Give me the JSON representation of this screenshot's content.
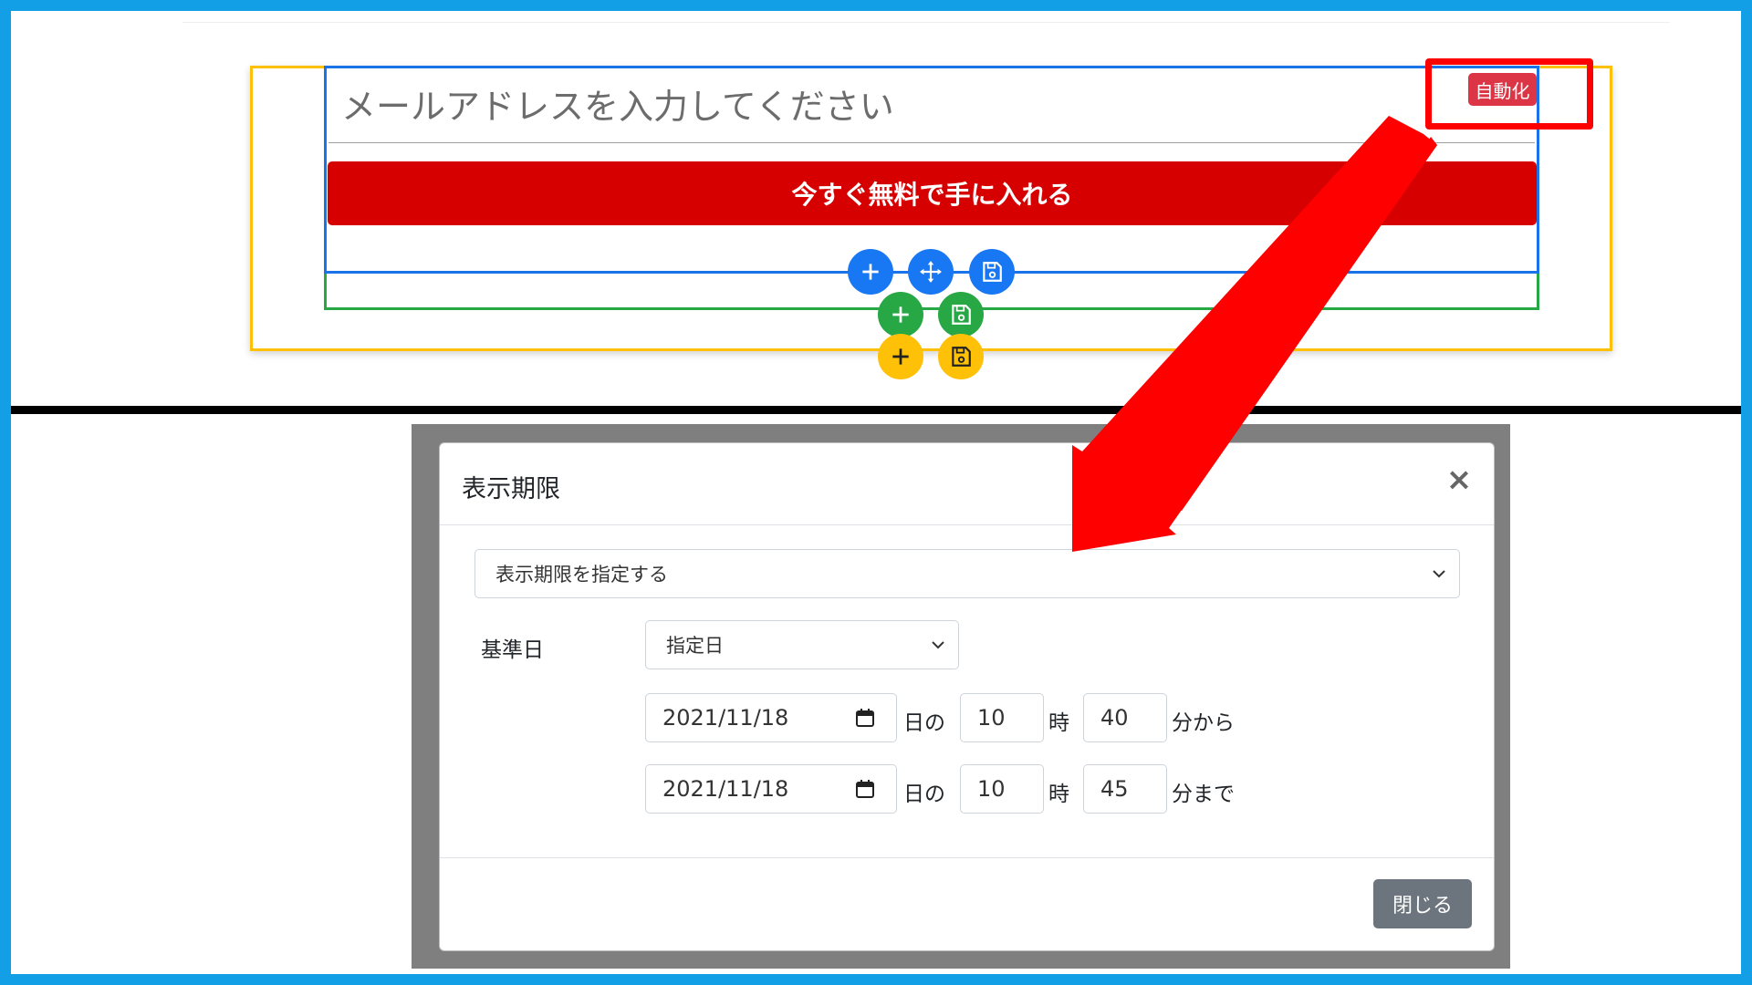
{
  "editor": {
    "email_placeholder": "メールアドレスを入力してください",
    "cta_label": "今すぐ無料で手に入れる",
    "auto_badge": "自動化",
    "block_controls": [
      {
        "icon": "plus-icon",
        "color": "#1877f2"
      },
      {
        "icon": "move-icon",
        "color": "#1877f2"
      },
      {
        "icon": "save-icon",
        "color": "#1877f2"
      },
      {
        "icon": "plus-icon",
        "color": "#28a745"
      },
      {
        "icon": "save-icon",
        "color": "#28a745"
      },
      {
        "icon": "plus-icon",
        "color": "#ffc107"
      },
      {
        "icon": "save-icon",
        "color": "#ffc107"
      }
    ]
  },
  "modal": {
    "title": "表示期限",
    "close_symbol": "×",
    "mode_select": "表示期限を指定する",
    "base_label": "基準日",
    "base_select": "指定日",
    "start": {
      "date": "2021/11/18",
      "day_suffix": "日の",
      "hour": "10",
      "hour_suffix": "時",
      "minute": "40",
      "minute_suffix": "分から"
    },
    "end": {
      "date": "2021/11/18",
      "day_suffix": "日の",
      "hour": "10",
      "hour_suffix": "時",
      "minute": "45",
      "minute_suffix": "分まで"
    },
    "close_button": "閉じる"
  },
  "colors": {
    "frame": "#129fe6",
    "cta": "#d60000",
    "badge": "#dc3545",
    "highlight": "#ff0000"
  }
}
